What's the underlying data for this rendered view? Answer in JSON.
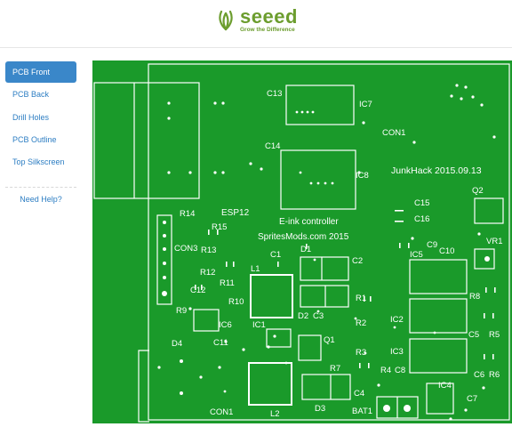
{
  "brand": {
    "name": "seeed",
    "tagline": "Grow the Difference",
    "color": "#6c9d2e"
  },
  "sidebar": {
    "items": [
      {
        "label": "PCB Front",
        "active": true
      },
      {
        "label": "PCB Back",
        "active": false
      },
      {
        "label": "Drill Holes",
        "active": false
      },
      {
        "label": "PCB Outline",
        "active": false
      },
      {
        "label": "Top Silkscreen",
        "active": false
      }
    ],
    "help_label": "Need Help?"
  },
  "pcb": {
    "board_color": "#1a9a2a",
    "silk_color": "#ffffff",
    "title_text": "JunkHack 2015.09.13",
    "controller_text": "E-ink controller",
    "site_text": "SpritesMods.com 2015",
    "labels": {
      "c13": "C13",
      "ic7": "IC7",
      "con1_top": "CON1",
      "c14": "C14",
      "ic8": "IC8",
      "c15": "C15",
      "c16": "C16",
      "q2": "Q2",
      "r14": "R14",
      "esp12": "ESP12",
      "r15": "R15",
      "vr1": "VR1",
      "con3": "CON3",
      "r13": "R13",
      "c9": "C9",
      "ic5": "IC5",
      "c10": "C10",
      "c1": "C1",
      "d1": "D1",
      "c2": "C2",
      "r12": "R12",
      "l1": "L1",
      "r11": "R11",
      "c12": "C12",
      "r10": "R10",
      "r1": "R1",
      "r8": "R8",
      "d2": "D2",
      "c3": "C3",
      "r9": "R9",
      "ic6": "IC6",
      "ic1": "IC1",
      "r2": "R2",
      "ic2": "IC2",
      "c5": "C5",
      "r5": "R5",
      "d4": "D4",
      "c11": "C11",
      "q1": "Q1",
      "r3": "R3",
      "ic3": "IC3",
      "r7": "R7",
      "r4": "R4",
      "c8": "C8",
      "c6": "C6",
      "r6": "R6",
      "ic4": "IC4",
      "c4": "C4",
      "c7": "C7",
      "con1_bottom": "CON1",
      "l2": "L2",
      "d3": "D3",
      "bat1": "BAT1"
    }
  }
}
